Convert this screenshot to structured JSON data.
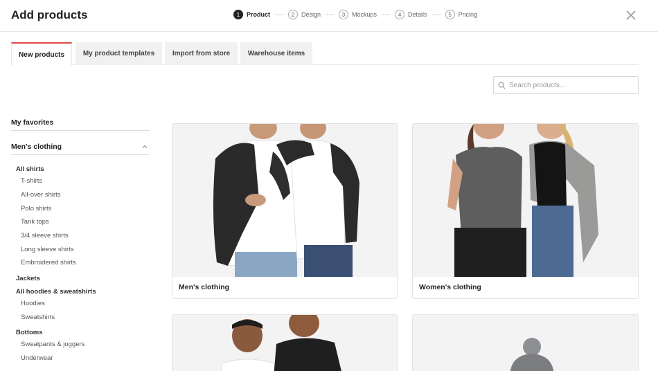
{
  "header": {
    "title": "Add products",
    "steps": [
      {
        "num": "1",
        "label": "Product"
      },
      {
        "num": "2",
        "label": "Design"
      },
      {
        "num": "3",
        "label": "Mockups"
      },
      {
        "num": "4",
        "label": "Details"
      },
      {
        "num": "5",
        "label": "Pricing"
      }
    ],
    "active_step": 1
  },
  "tabs": [
    {
      "label": "New products"
    },
    {
      "label": "My product templates"
    },
    {
      "label": "Import from store"
    },
    {
      "label": "Warehouse items"
    }
  ],
  "search": {
    "placeholder": "Search products..."
  },
  "sidebar": {
    "favorites": "My favorites",
    "category": "Men's clothing",
    "items": [
      {
        "label": "All shirts",
        "group": true
      },
      {
        "label": "T-shirts"
      },
      {
        "label": "All-over shirts"
      },
      {
        "label": "Polo shirts"
      },
      {
        "label": "Tank tops"
      },
      {
        "label": "3/4 sleeve shirts"
      },
      {
        "label": "Long sleeve shirts"
      },
      {
        "label": "Embroidered shirts"
      },
      {
        "label": "Jackets",
        "group": true
      },
      {
        "label": "All hoodies & sweatshirts",
        "group": true
      },
      {
        "label": "Hoodies"
      },
      {
        "label": "Sweatshirts"
      },
      {
        "label": "Bottoms",
        "group": true
      },
      {
        "label": "Sweatpants & joggers"
      },
      {
        "label": "Underwear"
      }
    ]
  },
  "cards": [
    {
      "label": "Men's clothing"
    },
    {
      "label": "Women's clothing"
    },
    {
      "label": ""
    },
    {
      "label": ""
    }
  ],
  "colors": {
    "accent": "#e04848",
    "text": "#222222",
    "muted": "#555555",
    "border": "#e3e3e3"
  }
}
